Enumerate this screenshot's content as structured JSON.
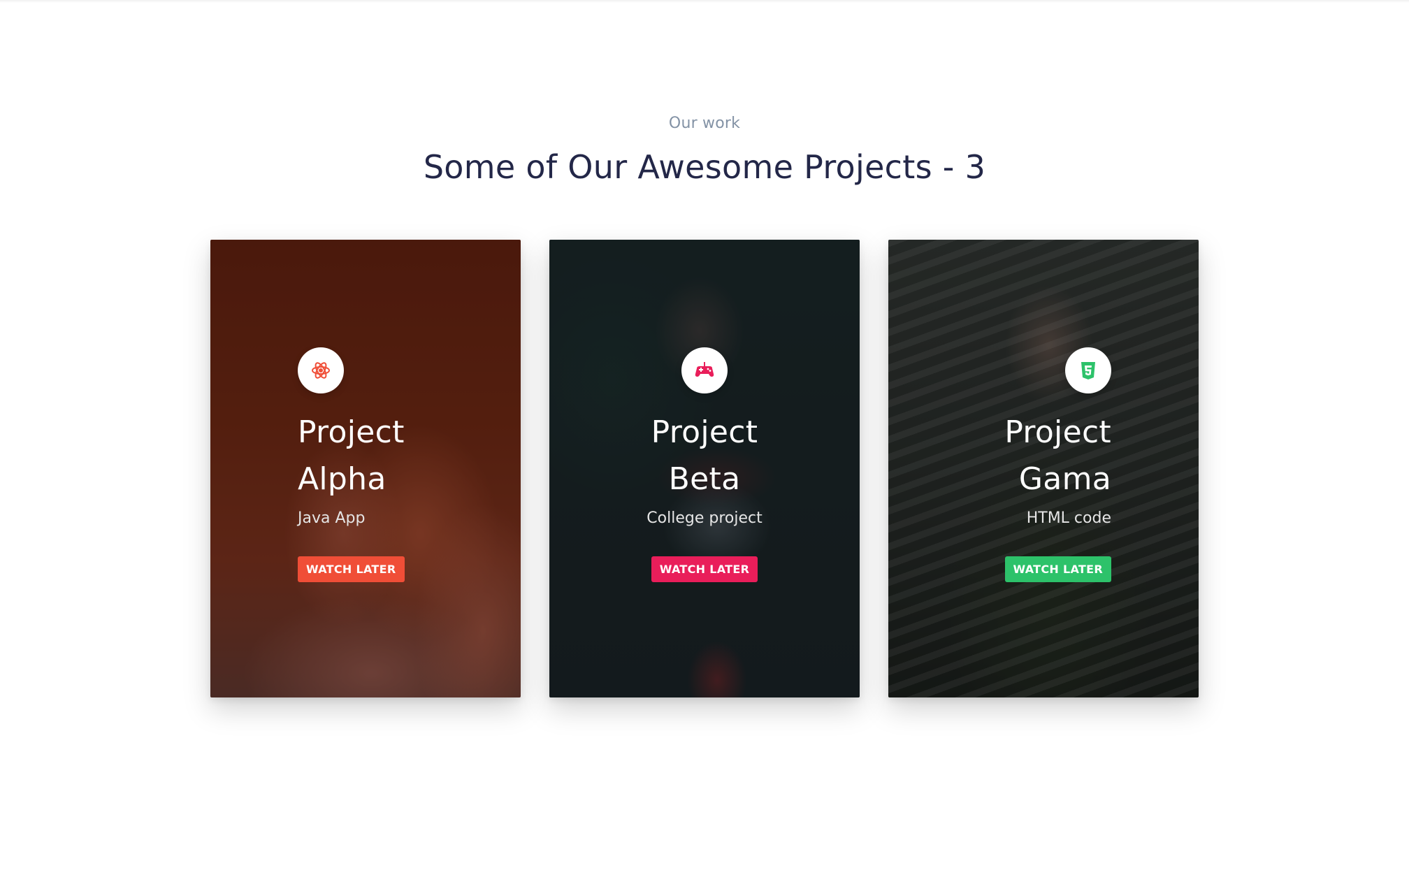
{
  "section": {
    "eyebrow": "Our work",
    "title": "Some of Our Awesome Projects - 3"
  },
  "cards": [
    {
      "title_line1": "Project",
      "title_line2": "Alpha",
      "subtitle": "Java App",
      "button_label": "Watch later",
      "icon": "atom-icon",
      "accent": "#f04e37"
    },
    {
      "title_line1": "Project",
      "title_line2": "Beta",
      "subtitle": "College project",
      "button_label": "Watch later",
      "icon": "gamepad-icon",
      "accent": "#e91e5a"
    },
    {
      "title_line1": "Project",
      "title_line2": "Gama",
      "subtitle": "HTML code",
      "button_label": "Watch later",
      "icon": "html5-icon",
      "accent": "#2dc26a"
    }
  ]
}
